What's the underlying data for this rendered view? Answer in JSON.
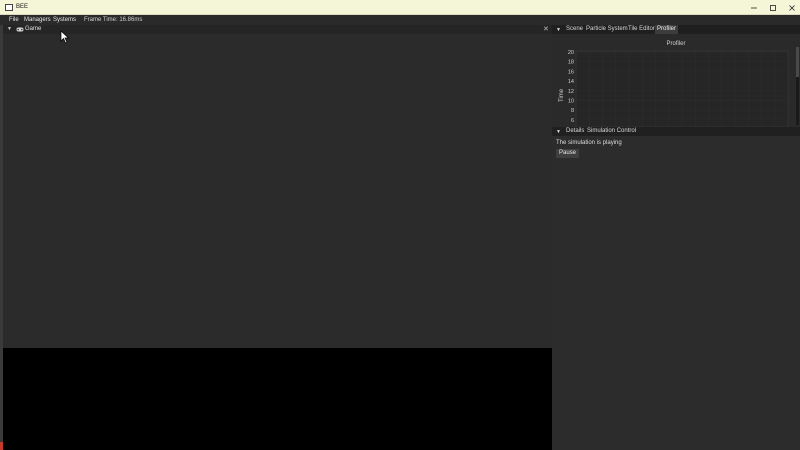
{
  "window": {
    "title": "BEE",
    "buttons": {
      "minimize": "—",
      "maximize": "☐",
      "close": "✕"
    }
  },
  "menubar": {
    "items": [
      "File",
      "Managers",
      "Systems"
    ],
    "frame_time": "Frame Time: 16.86ms"
  },
  "game_panel": {
    "tab_label": "Game",
    "caret": "▼",
    "close": "✕"
  },
  "right_top": {
    "caret": "▼",
    "tabs": [
      "Scene",
      "Particle System",
      "Tile Editor",
      "Profiler"
    ],
    "active_tab": "Profiler",
    "profiler": {
      "title": "Profiler",
      "y_label": "Time",
      "y_ticks": [
        "20",
        "18",
        "16",
        "14",
        "12",
        "10",
        "8",
        "6"
      ]
    }
  },
  "right_bottom": {
    "caret": "▼",
    "tabs": [
      "Details",
      "Simulation Control"
    ],
    "status_text": "The simulation is playing",
    "pause_button": "Pause"
  },
  "colors": {
    "titlebar": "#f5f6d7",
    "panel_bg": "#2a2a2a",
    "game_lower": "#000000",
    "accent": "#c53a2a"
  }
}
